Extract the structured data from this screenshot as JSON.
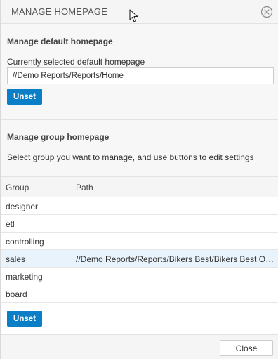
{
  "dialog": {
    "title": "MANAGE HOMEPAGE",
    "close_icon": "close-circle-icon"
  },
  "default_section": {
    "title": "Manage default homepage",
    "label": "Currently selected default homepage",
    "current_value": "//Demo Reports/Reports/Home",
    "unset_label": "Unset"
  },
  "group_section": {
    "title": "Manage group homepage",
    "instructions": "Select group you want to manage, and use buttons to edit settings",
    "columns": [
      "Group",
      "Path"
    ],
    "rows": [
      {
        "group": "designer",
        "path": ""
      },
      {
        "group": "etl",
        "path": ""
      },
      {
        "group": "controlling",
        "path": ""
      },
      {
        "group": "sales",
        "path": "//Demo Reports/Reports/Bikers Best/Bikers Best Overview",
        "selected": true
      },
      {
        "group": "marketing",
        "path": ""
      },
      {
        "group": "board",
        "path": ""
      }
    ],
    "unset_label": "Unset"
  },
  "footer": {
    "close_label": "Close"
  },
  "colors": {
    "accent": "#0a7fc7",
    "selected_row": "#e9f3fb"
  }
}
